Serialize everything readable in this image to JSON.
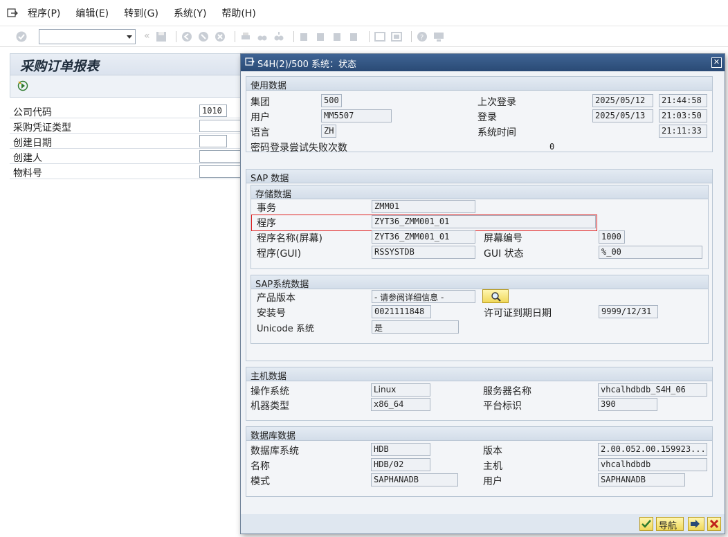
{
  "menu": {
    "items": [
      "程序(P)",
      "编辑(E)",
      "转到(G)",
      "系统(Y)",
      "帮助(H)"
    ]
  },
  "toolbar": {
    "command_field": ""
  },
  "main": {
    "title": "采购订单报表",
    "fields": [
      {
        "label": "公司代码",
        "value": "1010"
      },
      {
        "label": "采购凭证类型",
        "value": ""
      },
      {
        "label": "创建日期",
        "value": ""
      },
      {
        "label": "创建人",
        "value": ""
      },
      {
        "label": "物料号",
        "value": ""
      }
    ]
  },
  "dialog": {
    "title": "S4H(2)/500 系统：状态",
    "usage": {
      "header": "使用数据",
      "client_label": "集团",
      "client": "500",
      "user_label": "用户",
      "user": "MM5507",
      "language_label": "语言",
      "language": "ZH",
      "pwd_fail_label": "密码登录尝试失败次数",
      "pwd_fail": "0",
      "last_login_label": "上次登录",
      "last_login_date": "2025/05/12",
      "last_login_time": "21:44:58",
      "login_label": "登录",
      "login_date": "2025/05/13",
      "login_time": "21:03:50",
      "systime_label": "系统时间",
      "systime": "21:11:33"
    },
    "sap": {
      "header": "SAP 数据",
      "repo": {
        "header": "存储数据",
        "transaction_label": "事务",
        "transaction": "ZMM01",
        "program_label": "程序",
        "program": "ZYT36_ZMM001_01",
        "program_screen_label": "程序名称(屏幕)",
        "program_screen": "ZYT36_ZMM001_01",
        "screen_no_label": "屏幕编号",
        "screen_no": "1000",
        "program_gui_label": "程序(GUI)",
        "program_gui": "RSSYSTDB",
        "gui_status_label": "GUI 状态",
        "gui_status": "%_00"
      },
      "system": {
        "header": "SAP系统数据",
        "product_label": "产品版本",
        "product": "- 请参阅详细信息 -",
        "install_label": "安装号",
        "install": "0021111848",
        "license_label": "许可证到期日期",
        "license": "9999/12/31",
        "unicode_label": "Unicode 系统",
        "unicode": "是"
      }
    },
    "host": {
      "header": "主机数据",
      "os_label": "操作系统",
      "os": "Linux",
      "server_label": "服务器名称",
      "server": "vhcalhdbdb_S4H_06",
      "machine_label": "机器类型",
      "machine": "x86_64",
      "platform_label": "平台标识",
      "platform": "390"
    },
    "db": {
      "header": "数据库数据",
      "dbsys_label": "数据库系统",
      "dbsys": "HDB",
      "version_label": "版本",
      "version": "2.00.052.00.159923...",
      "name_label": "名称",
      "name": "HDB/02",
      "host_label": "主机",
      "host": "vhcalhdbdb",
      "schema_label": "模式",
      "schema": "SAPHANADB",
      "user_label": "用户",
      "user": "SAPHANADB"
    },
    "footer": {
      "nav_label": "导航"
    }
  },
  "colors": {
    "title_bar": "#2a4a75",
    "highlight": "#e02020",
    "button_yellow": "#f0d85a"
  }
}
